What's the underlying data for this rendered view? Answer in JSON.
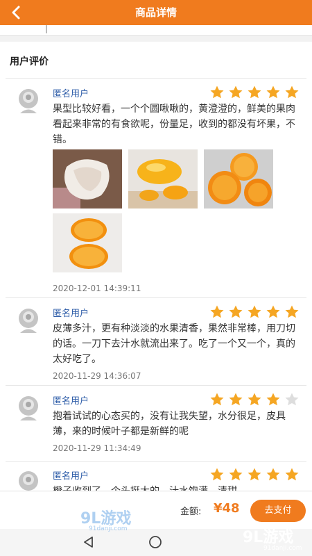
{
  "header": {
    "title": "商品详情",
    "back_icon": "chevron-left-icon"
  },
  "section": {
    "title": "用户评价"
  },
  "reviews": [
    {
      "user": "匿名用户",
      "rating": 5,
      "content": "果型比较好看，一个个圆啾啾的，黄澄澄的，鲜美的果肉看起来非常的有食欲呢，份量足，收到的都没有坏果，不错。",
      "photos": [
        "peeled-orange-photo",
        "orange-box-photo",
        "orange-slices-photo",
        "halved-orange-photo"
      ],
      "time": "2020-12-01 14:39:11"
    },
    {
      "user": "匿名用户",
      "rating": 5,
      "content": "皮薄多汁，更有种淡淡的水果清香，果然非常棒，用刀切的话。一刀下去汁水就流出来了。吃了一个又一个，真的太好吃了。",
      "photos": [],
      "time": "2020-11-29 14:36:07"
    },
    {
      "user": "匿名用户",
      "rating": 4,
      "content": "抱着试试的心态买的，没有让我失望，水分很足，皮具薄，来的时候叶子都是新鲜的呢",
      "photos": [],
      "time": "2020-11-29 11:34:49"
    },
    {
      "user": "匿名用户",
      "rating": 5,
      "content": "橙子收到了，个头挺大的，汁水饱满，清甜",
      "photos": [],
      "time": ""
    }
  ],
  "footer": {
    "amount_label": "金额:",
    "amount_value": "¥48",
    "pay_label": "去支付"
  },
  "colors": {
    "accent": "#f07b1e",
    "star_on": "#f5a623",
    "star_off": "#dddddd",
    "username": "#2d5ca8"
  },
  "watermark": {
    "brand": "9L游戏",
    "site": "91danji.com"
  }
}
